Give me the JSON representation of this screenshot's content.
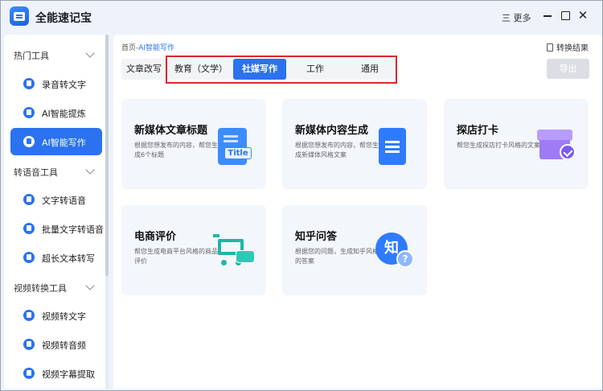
{
  "app": {
    "title": "全能速记宝",
    "more_label": "三 更多"
  },
  "sidebar": {
    "groups": [
      {
        "label": "热门工具",
        "items": [
          {
            "label": "录音转文字"
          },
          {
            "label": "AI智能提炼"
          },
          {
            "label": "AI智能写作",
            "active": true
          }
        ]
      },
      {
        "label": "转语音工具",
        "items": [
          {
            "label": "文字转语音"
          },
          {
            "label": "批量文字转语音"
          },
          {
            "label": "超长文本转写"
          }
        ]
      },
      {
        "label": "视频转换工具",
        "items": [
          {
            "label": "视频转文字"
          },
          {
            "label": "视频转音频"
          },
          {
            "label": "视频字幕提取"
          }
        ]
      }
    ]
  },
  "main": {
    "breadcrumb": {
      "home": "首页-",
      "current": "AI智能写作"
    },
    "convert_result": "转换结果",
    "export_label": "导出",
    "tabs": [
      {
        "label": "文章改写"
      },
      {
        "label": "教育（文学）"
      },
      {
        "label": "社媒写作",
        "active": true
      },
      {
        "label": "工作"
      },
      {
        "label": "通用"
      }
    ],
    "cards": [
      {
        "title": "新媒体文章标题",
        "desc": "根据您想发布的内容，帮您生成6个标题",
        "icon": "title-doc-icon",
        "art_text": "Title"
      },
      {
        "title": "新媒体内容生成",
        "desc": "根据您想发布的内容，帮您生成新媒体风格文案",
        "icon": "document-icon"
      },
      {
        "title": "探店打卡",
        "desc": "帮您生成探店打卡风格的文案",
        "icon": "shop-check-icon"
      },
      {
        "title": "电商评价",
        "desc": "帮您生成电商平台风格的商品评价",
        "icon": "shopping-cart-icon"
      },
      {
        "title": "知乎问答",
        "desc": "根据您的问题，生成知乎风格的答案",
        "icon": "zhihu-qa-icon",
        "art_text": "知",
        "art_text2": "?"
      }
    ]
  },
  "colors": {
    "accent": "#2a72f0",
    "highlight_border": "#e2242b"
  }
}
